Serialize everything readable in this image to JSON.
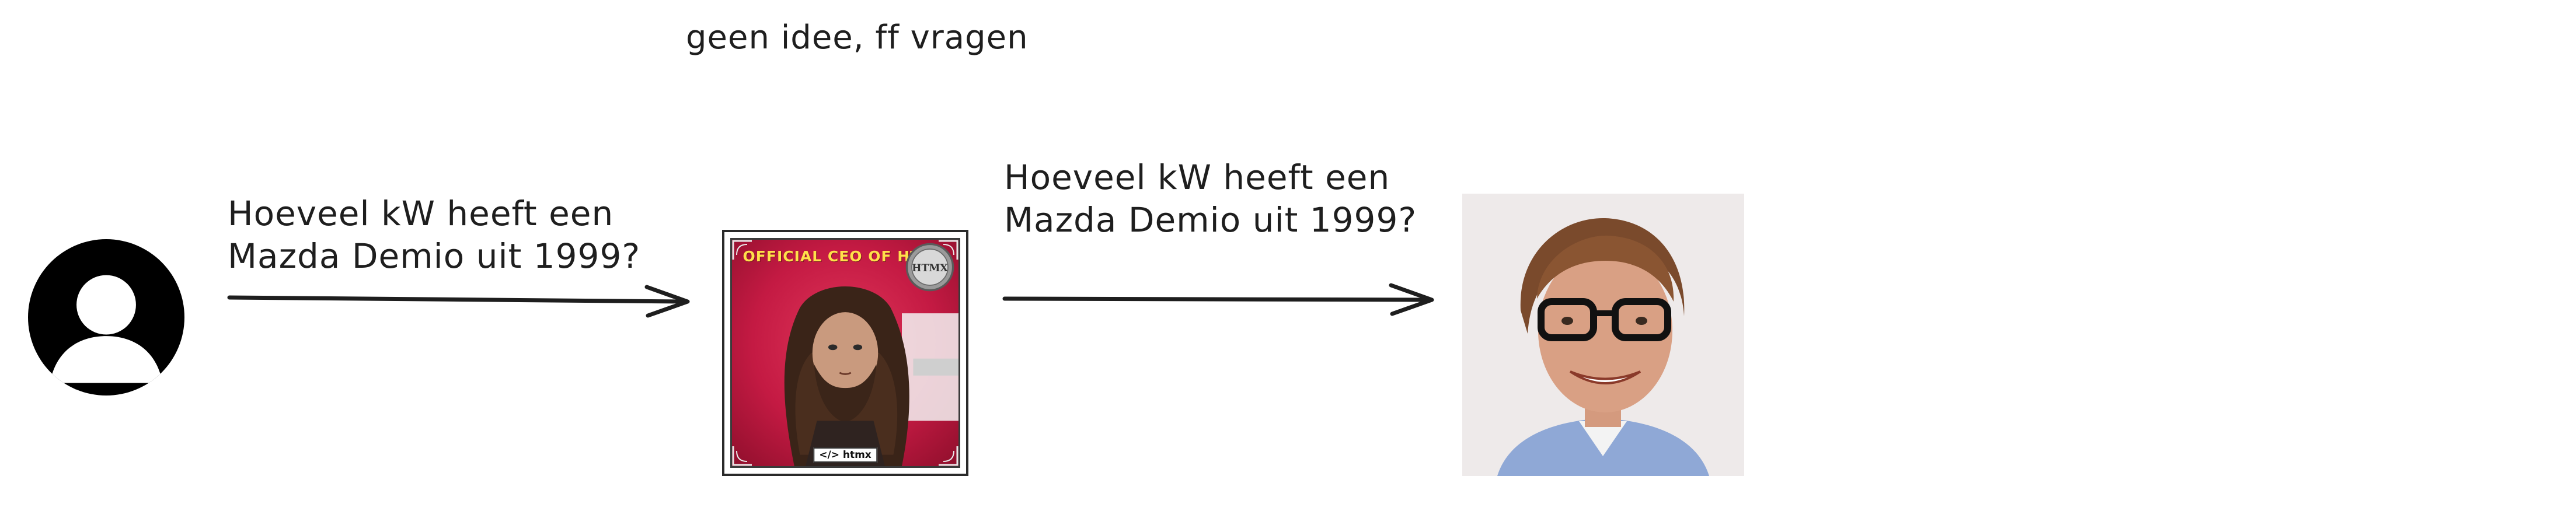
{
  "annotations": {
    "note_top": "geen idee, ff vragen"
  },
  "messages": {
    "question_1": "Hoeveel kW heeft een\nMazda Demio uit 1999?",
    "question_2": "Hoeveel kW heeft een\nMazda Demio uit 1999?"
  },
  "nodes": {
    "user": {
      "icon": "user-avatar-icon",
      "color": "#000000"
    },
    "ceo_card": {
      "banner": "OFFICIAL CEO OF HTMX",
      "seal_text": "HTMX",
      "badge": "</> htmx",
      "background_color": "#c41a43",
      "banner_color": "#ffe04a"
    },
    "expert": {
      "icon": "person-photo",
      "background_color": "#eeeaea"
    }
  },
  "connectors": {
    "stroke_color": "#1e1e1e"
  }
}
